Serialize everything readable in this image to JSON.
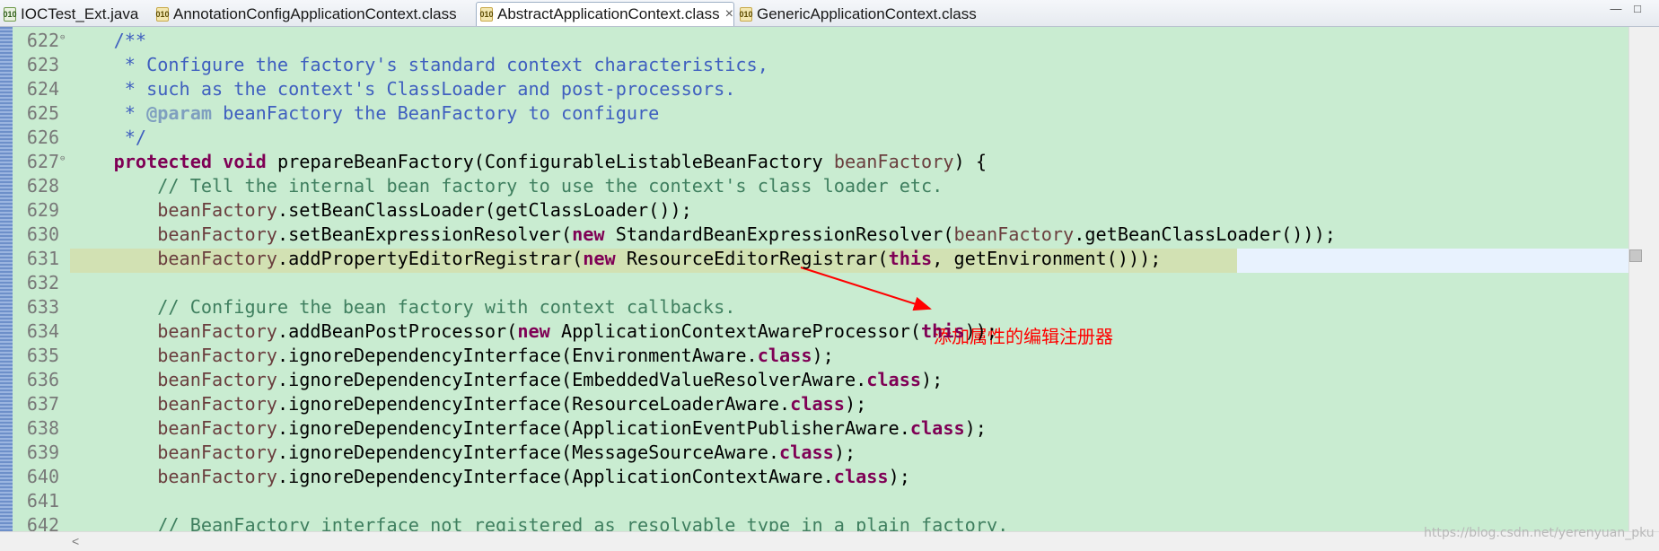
{
  "tabs": [
    {
      "label": "IOCTest_Ext.java",
      "icon": "java-file-icon",
      "active": false
    },
    {
      "label": "AnnotationConfigApplicationContext.class",
      "icon": "class-file-icon",
      "active": false
    },
    {
      "label": "AbstractApplicationContext.class",
      "icon": "class-file-icon",
      "active": true
    },
    {
      "label": "GenericApplicationContext.class",
      "icon": "class-file-icon",
      "active": false
    }
  ],
  "tab_icon_text": "010",
  "close_glyph": "×",
  "window_buttons": {
    "minimize": "—",
    "maximize": "□"
  },
  "lines": [
    {
      "num": "622",
      "fold": "⊖",
      "segs": [
        [
          "doc",
          "    /**"
        ]
      ]
    },
    {
      "num": "623",
      "segs": [
        [
          "doc",
          "     * Configure the factory's standard context characteristics,"
        ]
      ]
    },
    {
      "num": "624",
      "segs": [
        [
          "doc",
          "     * such as the context's ClassLoader and post-processors."
        ]
      ]
    },
    {
      "num": "625",
      "segs": [
        [
          "doc",
          "     * "
        ],
        [
          "doctag",
          "@param"
        ],
        [
          "doc",
          " beanFactory the BeanFactory to configure"
        ]
      ]
    },
    {
      "num": "626",
      "segs": [
        [
          "doc",
          "     */"
        ]
      ]
    },
    {
      "num": "627",
      "fold": "⊖",
      "segs": [
        [
          "plain",
          "    "
        ],
        [
          "kw",
          "protected"
        ],
        [
          "plain",
          " "
        ],
        [
          "kw",
          "void"
        ],
        [
          "plain",
          " prepareBeanFactory(ConfigurableListableBeanFactory "
        ],
        [
          "fld",
          "beanFactory"
        ],
        [
          "plain",
          ") {"
        ]
      ]
    },
    {
      "num": "628",
      "segs": [
        [
          "cm",
          "        // Tell the internal bean factory to use the context's class loader etc."
        ]
      ]
    },
    {
      "num": "629",
      "segs": [
        [
          "fld",
          "        beanFactory"
        ],
        [
          "plain",
          ".setBeanClassLoader(getClassLoader());"
        ]
      ]
    },
    {
      "num": "630",
      "segs": [
        [
          "fld",
          "        beanFactory"
        ],
        [
          "plain",
          ".setBeanExpressionResolver("
        ],
        [
          "kw",
          "new"
        ],
        [
          "plain",
          " StandardBeanExpressionResolver("
        ],
        [
          "fld",
          "beanFactory"
        ],
        [
          "plain",
          ".getBeanClassLoader()));"
        ]
      ]
    },
    {
      "num": "631",
      "segs": [
        [
          "fld",
          "        beanFactory"
        ],
        [
          "plain",
          ".addPropertyEditorRegistrar("
        ],
        [
          "kw",
          "new"
        ],
        [
          "plain",
          " ResourceEditorRegistrar("
        ],
        [
          "kw",
          "this"
        ],
        [
          "plain",
          ", getEnvironment()));"
        ]
      ]
    },
    {
      "num": "632",
      "segs": [
        [
          "plain",
          ""
        ]
      ]
    },
    {
      "num": "633",
      "segs": [
        [
          "cm",
          "        // Configure the bean factory with context callbacks."
        ]
      ]
    },
    {
      "num": "634",
      "segs": [
        [
          "fld",
          "        beanFactory"
        ],
        [
          "plain",
          ".addBeanPostProcessor("
        ],
        [
          "kw",
          "new"
        ],
        [
          "plain",
          " ApplicationContextAwareProcessor("
        ],
        [
          "kw",
          "this"
        ],
        [
          "plain",
          "));"
        ]
      ]
    },
    {
      "num": "635",
      "segs": [
        [
          "fld",
          "        beanFactory"
        ],
        [
          "plain",
          ".ignoreDependencyInterface(EnvironmentAware."
        ],
        [
          "kw",
          "class"
        ],
        [
          "plain",
          ");"
        ]
      ]
    },
    {
      "num": "636",
      "segs": [
        [
          "fld",
          "        beanFactory"
        ],
        [
          "plain",
          ".ignoreDependencyInterface(EmbeddedValueResolverAware."
        ],
        [
          "kw",
          "class"
        ],
        [
          "plain",
          ");"
        ]
      ]
    },
    {
      "num": "637",
      "segs": [
        [
          "fld",
          "        beanFactory"
        ],
        [
          "plain",
          ".ignoreDependencyInterface(ResourceLoaderAware."
        ],
        [
          "kw",
          "class"
        ],
        [
          "plain",
          ");"
        ]
      ]
    },
    {
      "num": "638",
      "segs": [
        [
          "fld",
          "        beanFactory"
        ],
        [
          "plain",
          ".ignoreDependencyInterface(ApplicationEventPublisherAware."
        ],
        [
          "kw",
          "class"
        ],
        [
          "plain",
          ");"
        ]
      ]
    },
    {
      "num": "639",
      "segs": [
        [
          "fld",
          "        beanFactory"
        ],
        [
          "plain",
          ".ignoreDependencyInterface(MessageSourceAware."
        ],
        [
          "kw",
          "class"
        ],
        [
          "plain",
          ");"
        ]
      ]
    },
    {
      "num": "640",
      "segs": [
        [
          "fld",
          "        beanFactory"
        ],
        [
          "plain",
          ".ignoreDependencyInterface(ApplicationContextAware."
        ],
        [
          "kw",
          "class"
        ],
        [
          "plain",
          ");"
        ]
      ]
    },
    {
      "num": "641",
      "segs": [
        [
          "plain",
          ""
        ]
      ]
    },
    {
      "num": "642",
      "segs": [
        [
          "cm",
          "        // BeanFactory interface not registered as resolvable type in a plain factory."
        ]
      ]
    }
  ],
  "current_line": "631",
  "annotation": {
    "text": "添加属性的编辑注册器",
    "color": "#ff0000"
  },
  "watermark": "https://blog.csdn.net/yerenyuan_pku",
  "colors": {
    "background": "#c9ecd1",
    "current_line": "#d2e1b3",
    "keyword": "#7f0055",
    "javadoc": "#3f5fbf",
    "comment": "#3f7f5f",
    "field": "#6a3e3e"
  }
}
